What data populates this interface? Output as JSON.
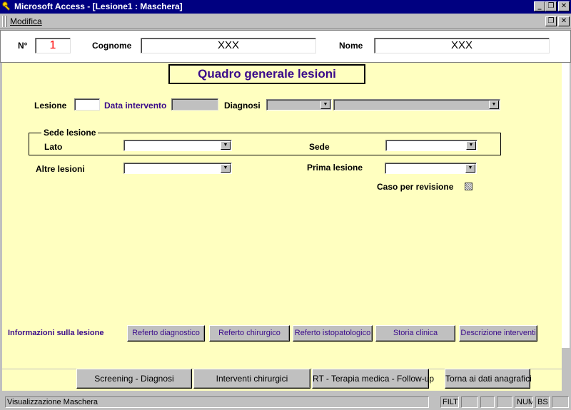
{
  "window": {
    "title": "Microsoft Access - [Lesione1 : Maschera]",
    "minimize_label": "_",
    "restore_label": "❐",
    "close_label": "✕"
  },
  "menu": {
    "modifica": "Modifica",
    "restore_label": "❐",
    "close_label": "✕"
  },
  "header": {
    "num_label": "N°",
    "num_value": "1",
    "cognome_label": "Cognome",
    "cognome_value": "XXX",
    "nome_label": "Nome",
    "nome_value": "XXX"
  },
  "form": {
    "title": "Quadro generale lesioni",
    "lesione_label": "Lesione",
    "lesione_value": "",
    "data_intervento_label": "Data intervento",
    "data_intervento_value": "",
    "diagnosi_label": "Diagnosi",
    "sede_group_label": "Sede lesione",
    "lato_label": "Lato",
    "sede_label": "Sede",
    "altre_lesioni_label": "Altre lesioni",
    "prima_lesione_label": "Prima lesione",
    "caso_revisione_label": "Caso per revisione",
    "info_label": "Informazioni sulla lesione",
    "info_buttons": [
      "Referto diagnostico",
      "Referto chirurgico",
      "Referto istopatologico",
      "Storia clinica",
      "Descrizione interventi"
    ],
    "dropdown_arrow": "▼"
  },
  "footer_buttons": [
    "Screening - Diagnosi",
    "Interventi chirurgici",
    "RT - Terapia medica - Follow-up",
    "Torna ai dati anagrafici"
  ],
  "statusbar": {
    "text": "Visualizzazione Maschera",
    "filt": "FILT",
    "num": "NUM",
    "bs": "BS"
  },
  "colors": {
    "titlebar": "#000080",
    "form_background": "#ffffc0",
    "accent_purple": "#3a0a8a",
    "number_red": "#ff0000"
  }
}
